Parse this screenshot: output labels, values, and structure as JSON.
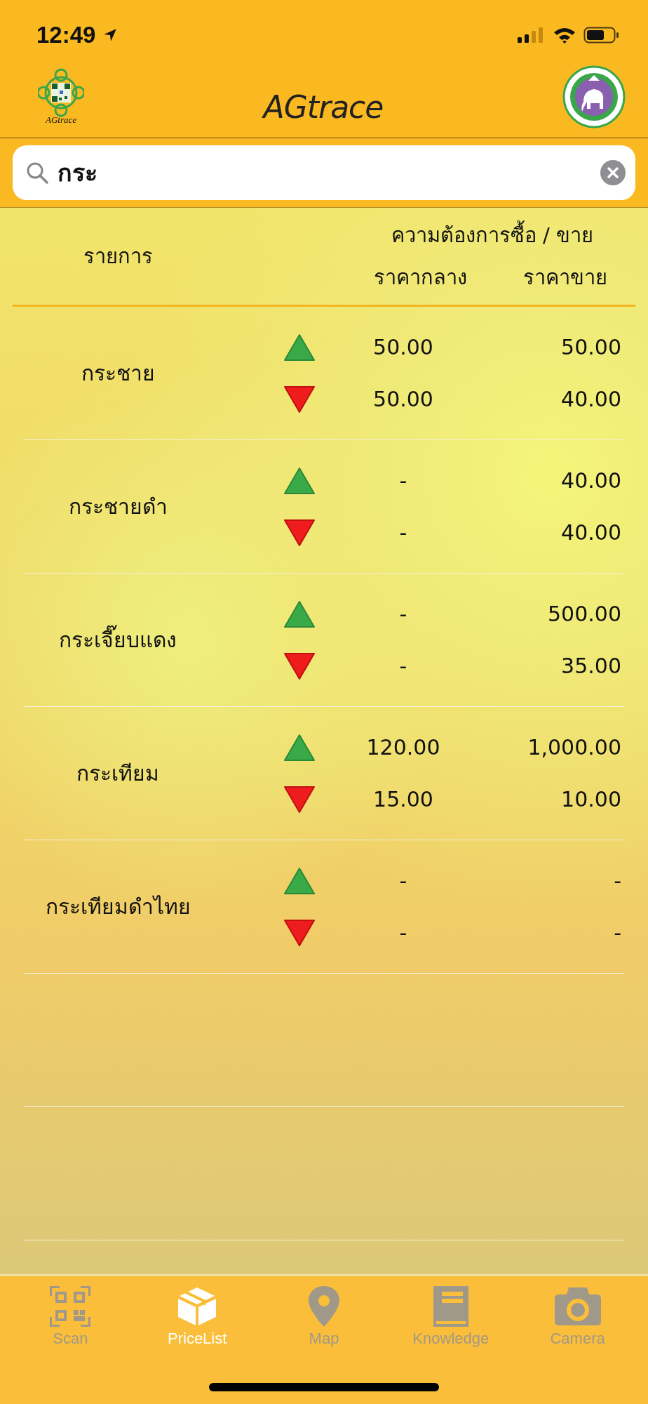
{
  "status_bar": {
    "time": "12:49"
  },
  "header": {
    "title": "AGtrace",
    "logo_caption": "AGtrace"
  },
  "search": {
    "value": "กระ"
  },
  "table": {
    "columns": {
      "item": "รายการ",
      "group": "ความต้องการซื้อ / ขาย",
      "mid": "ราคากลาง",
      "sell": "ราคาขาย"
    },
    "rows": [
      {
        "name": "กระชาย",
        "lines": [
          {
            "kind": "up",
            "mid": "50.00",
            "sell": "50.00"
          },
          {
            "kind": "down",
            "mid": "50.00",
            "sell": "40.00"
          }
        ]
      },
      {
        "name": "กระชายดำ",
        "lines": [
          {
            "kind": "up",
            "mid": "-",
            "sell": "40.00"
          },
          {
            "kind": "down",
            "mid": "-",
            "sell": "40.00"
          }
        ]
      },
      {
        "name": "กระเจี๊ยบแดง",
        "lines": [
          {
            "kind": "up",
            "mid": "-",
            "sell": "500.00"
          },
          {
            "kind": "down",
            "mid": "-",
            "sell": "35.00"
          }
        ]
      },
      {
        "name": "กระเทียม",
        "lines": [
          {
            "kind": "up",
            "mid": "120.00",
            "sell": "1,000.00"
          },
          {
            "kind": "down",
            "mid": "15.00",
            "sell": "10.00"
          }
        ]
      },
      {
        "name": "กระเทียมดำไทย",
        "lines": [
          {
            "kind": "up",
            "mid": "-",
            "sell": "-"
          },
          {
            "kind": "down",
            "mid": "-",
            "sell": "-"
          }
        ]
      }
    ]
  },
  "tabs": [
    {
      "label": "Scan",
      "kind": "scan",
      "selected": false
    },
    {
      "label": "PriceList",
      "kind": "box",
      "selected": true
    },
    {
      "label": "Map",
      "kind": "pin",
      "selected": false
    },
    {
      "label": "Knowledge",
      "kind": "book",
      "selected": false
    },
    {
      "label": "Camera",
      "kind": "camera",
      "selected": false
    }
  ]
}
